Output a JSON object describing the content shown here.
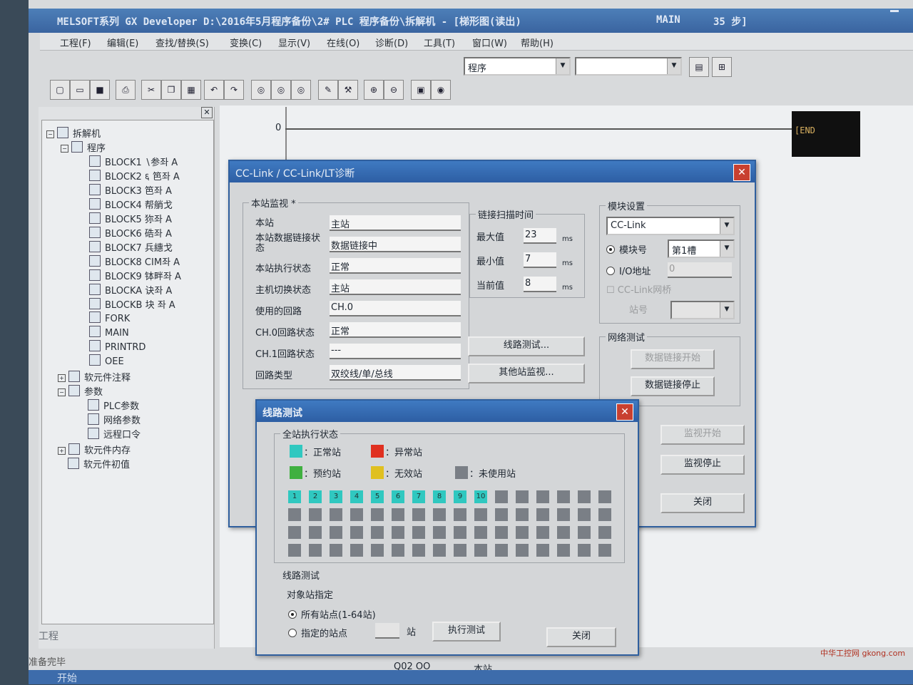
{
  "window": {
    "title": "MELSOFT系列 GX Developer D:\\2016年5月程序备份\\2# PLC 程序备份\\拆解机 - [梯形图(读出)",
    "program_name": "MAIN",
    "steps": "35 步]"
  },
  "menu": [
    "工程(F)",
    "编辑(E)",
    "查找/替换(S)",
    "变换(C)",
    "显示(V)",
    "在线(O)",
    "诊断(D)",
    "工具(T)",
    "窗口(W)",
    "帮助(H)"
  ],
  "toolbar": {
    "combo_left": "程序",
    "combo_right": "",
    "icons": [
      "new-icon",
      "open-icon",
      "save-icon",
      "print-icon",
      "cut-icon",
      "copy-icon",
      "paste-icon",
      "undo-icon",
      "redo-icon",
      "find-device-icon",
      "find-instruction-icon",
      "find-step-icon",
      "write-icon",
      "read-icon",
      "monitor-icon",
      "monitor-write-icon",
      "zoom-in-icon",
      "zoom-out-icon"
    ]
  },
  "project_tree": {
    "root": "拆解机",
    "program": "程序",
    "blocks": [
      "BLOCK1 ∖参좌 A",
      "BLOCK2 ६ 笆좌 A",
      "BLOCK3  笆좌 A",
      "BLOCK4 帮艄戈",
      "BLOCK5  狝좌 A",
      "BLOCK6 硞좌 A",
      "BLOCK7 兵繐戈",
      "BLOCK8 CIM좌 A",
      "BLOCK9 钵畔좌 A",
      "BLOCKA  诀좌 A",
      "BLOCKB 块  좌 A",
      "FORK",
      "MAIN",
      "PRINTRD",
      "OEE"
    ],
    "comment": "软元件注释",
    "param": "参数",
    "param_items": [
      "PLC参数",
      "网络参数",
      "远程口令"
    ],
    "memory": "软元件内存",
    "initial": "软元件初值",
    "tab": "工程"
  },
  "status_bar": {
    "ready": "准备完毕",
    "cpu": "Q02 OO",
    "station": "本站"
  },
  "ladder": {
    "step": "0",
    "end": "[END"
  },
  "cclink_dialog": {
    "title": "CC-Link / CC-Link/LT诊断",
    "host_group": "本站监视 *",
    "rows": [
      {
        "label": "本站",
        "value": "主站"
      },
      {
        "label": "本站数据链接状态",
        "value": "数据链接中"
      },
      {
        "label": "本站执行状态",
        "value": "正常"
      },
      {
        "label": "主机切换状态",
        "value": "主站"
      },
      {
        "label": "使用的回路",
        "value": "CH.0"
      },
      {
        "label": "CH.0回路状态",
        "value": "正常"
      },
      {
        "label": "CH.1回路状态",
        "value": "---"
      },
      {
        "label": "回路类型",
        "value": "双绞线/单/总线"
      }
    ],
    "scan_group": "链接扫描时间",
    "scan": [
      {
        "label": "最大值",
        "value": "23",
        "unit": "ms"
      },
      {
        "label": "最小值",
        "value": "7",
        "unit": "ms"
      },
      {
        "label": "当前值",
        "value": "8",
        "unit": "ms"
      }
    ],
    "module_group": "模块设置",
    "module_type": "CC-Link",
    "module_no_label": "模块号",
    "module_no": "第1槽",
    "io_label": "I/O地址",
    "io_value": "0",
    "bridge_label": "CC-Link网桥",
    "station_no_label": "站号",
    "line_test_btn": "线路测试...",
    "other_station_btn": "其他站监视...",
    "net_test_group": "网络测试",
    "link_start_btn": "数据链接开始",
    "link_stop_btn": "数据链接停止",
    "monitor_start_btn": "监视开始",
    "monitor_stop_btn": "监视停止",
    "close_btn": "关闭"
  },
  "line_test_dialog": {
    "title": "线路测试",
    "all_status_group": "全站执行状态",
    "legend": [
      {
        "label": "：正常站",
        "color": "#30c8c0"
      },
      {
        "label": "：异常站",
        "color": "#e03020"
      },
      {
        "label": "：预约站",
        "color": "#40b040"
      },
      {
        "label": "：无效站",
        "color": "#e0c020"
      },
      {
        "label": "：未使用站",
        "color": "#7a7f86"
      }
    ],
    "active_stations": [
      "1",
      "2",
      "3",
      "4",
      "5",
      "6",
      "7",
      "8",
      "9",
      "10"
    ],
    "total_stations": 64,
    "test_group": "线路测试",
    "target_label": "对象站指定",
    "all_stations": "所有站点(1-64站)",
    "specified": "指定的站点",
    "station_unit": "站",
    "run_btn": "执行测试",
    "close_btn": "关闭"
  },
  "taskbar": {
    "start": "开始"
  },
  "watermark": "中华工控网 gkong.com"
}
